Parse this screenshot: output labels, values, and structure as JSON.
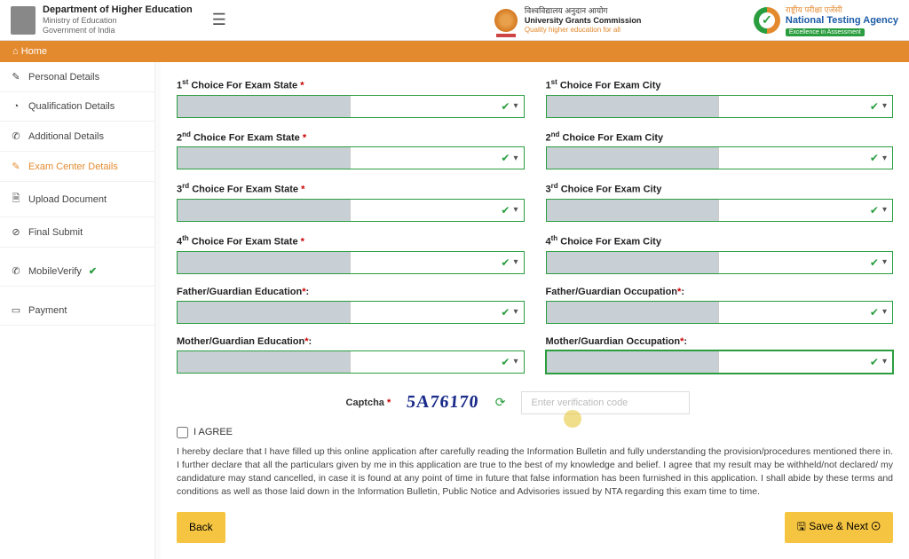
{
  "header": {
    "dept": "Department of Higher Education",
    "ministry": "Ministry of Education",
    "gov": "Government of India",
    "ugc_hi": "विश्वविद्यालय अनुदान आयोग",
    "ugc_en": "University Grants Commission",
    "ugc_tag": "Quality higher education for all",
    "nta_hi": "राष्ट्रीय परीक्षा एजेंसी",
    "nta_en": "National Testing Agency",
    "nta_strip": "Excellence in Assessment"
  },
  "nav": {
    "home": "Home"
  },
  "sidebar": [
    {
      "icon": "👤",
      "label": "Personal Details",
      "active": false
    },
    {
      "icon": "🎓",
      "label": "Qualification Details",
      "active": false
    },
    {
      "icon": "📞",
      "label": "Additional Details",
      "active": false
    },
    {
      "icon": "✎",
      "label": "Exam Center Details",
      "active": true
    },
    {
      "icon": "🗎",
      "label": "Upload Document",
      "active": false
    },
    {
      "icon": "⊘",
      "label": "Final Submit",
      "active": false
    }
  ],
  "sidebar_extra": {
    "mobile": "MobileVerify",
    "payment": "Payment"
  },
  "fields": {
    "state1": "Choice For Exam State",
    "city1": "Choice For Exam City",
    "state2": "Choice For Exam State",
    "city2": "Choice For Exam City",
    "state3": "Choice For Exam State",
    "city3": "Choice For Exam City",
    "state4": "Choice For Exam State",
    "city4": "Choice For Exam City",
    "father_edu": "Father/Guardian Education",
    "father_occ": "Father/Guardian Occupation",
    "mother_edu": "Mother/Guardian Education",
    "mother_occ": "Mother/Guardian Occupation"
  },
  "ordinals": {
    "1": "1",
    "1s": "st",
    "2": "2",
    "2s": "nd",
    "3": "3",
    "3s": "rd",
    "4": "4",
    "4s": "th"
  },
  "captcha": {
    "label": "Captcha",
    "value": "5A76170",
    "placeholder": "Enter verification code"
  },
  "agree": {
    "label": "I AGREE",
    "text": "I hereby declare that I have filled up this online application after carefully reading the Information Bulletin and fully understanding the provision/procedures mentioned there in. I further declare that all the particulars given by me in this application are true to the best of my knowledge and belief. I agree that my result may be withheld/not declared/ my candidature may stand cancelled, in case it is found at any point of time in future that false information has been furnished in this application. I shall abide by these terms and conditions as well as those laid down in the Information Bulletin, Public Notice and Advisories issued by NTA regarding this exam time to time."
  },
  "buttons": {
    "back": "Back",
    "save": "🖫 Save & Next ⊙"
  }
}
